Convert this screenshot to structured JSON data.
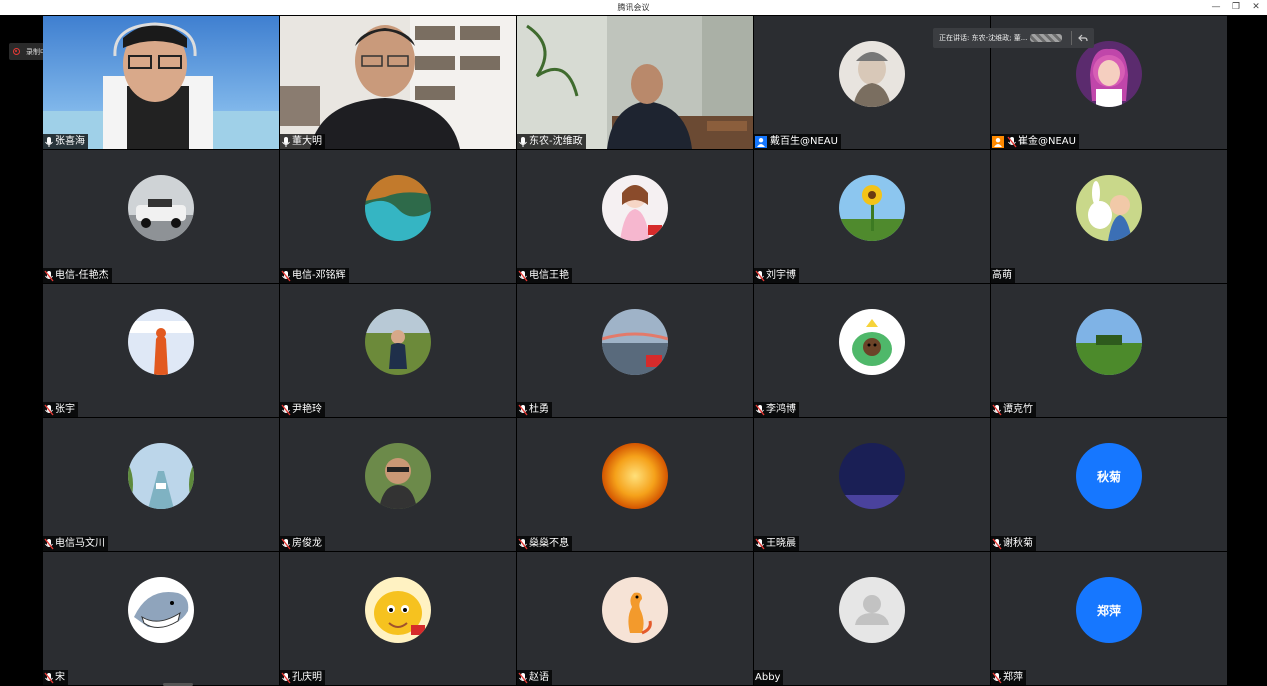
{
  "window": {
    "title": "腾讯会议"
  },
  "recording": {
    "label": "录制中"
  },
  "speaking": {
    "label": "正在讲话: 东农-沈维政; 董..."
  },
  "colors": {
    "tile_bg": "#2b2d31",
    "accent_blue": "#1677ff",
    "record_red": "#e53935",
    "active_green": "#2ecc71"
  },
  "participants": [
    {
      "name": "张喜海"
    },
    {
      "name": "董大明"
    },
    {
      "name": "东农-沈维政"
    },
    {
      "name": "戴百生@NEAU"
    },
    {
      "name": "崔金@NEAU"
    },
    {
      "name": "电信-任艳杰"
    },
    {
      "name": "电信-邓铭辉"
    },
    {
      "name": "电信王艳"
    },
    {
      "name": "刘宇博"
    },
    {
      "name": "高萌"
    },
    {
      "name": "张宇"
    },
    {
      "name": "尹艳玲"
    },
    {
      "name": "杜勇"
    },
    {
      "name": "李鸿博"
    },
    {
      "name": "谭克竹"
    },
    {
      "name": "电信马文川"
    },
    {
      "name": "房俊龙"
    },
    {
      "name": "燊燊不息"
    },
    {
      "name": "王晓晨"
    },
    {
      "name": "谢秋菊",
      "avatar_text": "秋菊"
    },
    {
      "name": "宋"
    },
    {
      "name": "孔庆明"
    },
    {
      "name": "赵语"
    },
    {
      "name": "Abby"
    },
    {
      "name": "郑萍",
      "avatar_text": "郑萍"
    }
  ]
}
